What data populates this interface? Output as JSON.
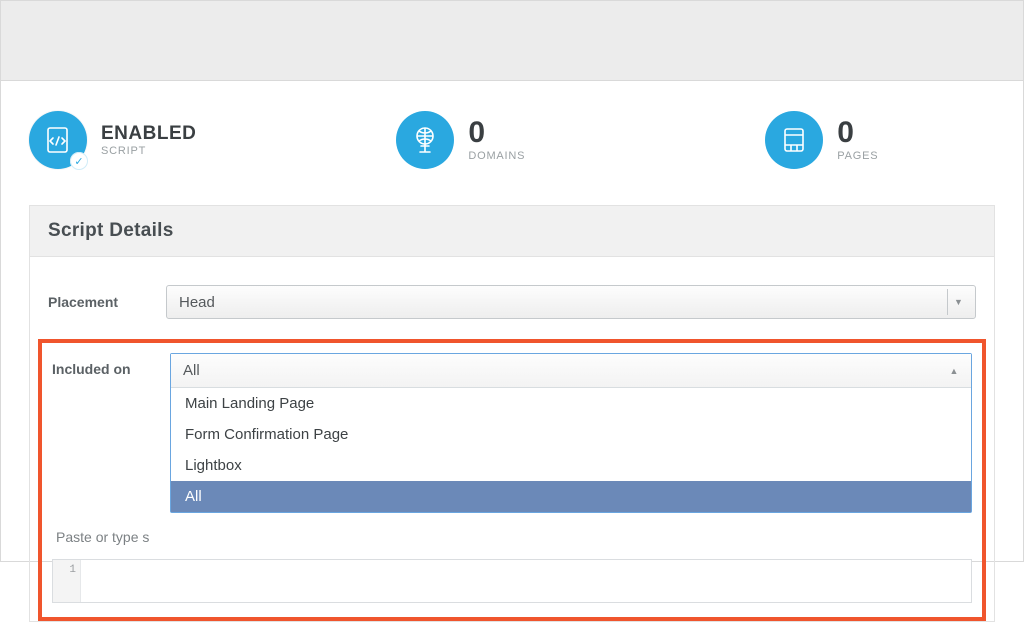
{
  "stats": {
    "script": {
      "status": "ENABLED",
      "label": "SCRIPT"
    },
    "domains": {
      "value": "0",
      "label": "DOMAINS"
    },
    "pages": {
      "value": "0",
      "label": "PAGES"
    }
  },
  "panel": {
    "title": "Script Details"
  },
  "placement": {
    "label": "Placement",
    "value": "Head"
  },
  "included": {
    "label": "Included on",
    "value": "All",
    "options": [
      "Main Landing Page",
      "Form Confirmation Page",
      "Lightbox",
      "All"
    ],
    "selected_index": 3
  },
  "prompt_truncated": "Paste or type s",
  "code": {
    "line_number": "1"
  }
}
